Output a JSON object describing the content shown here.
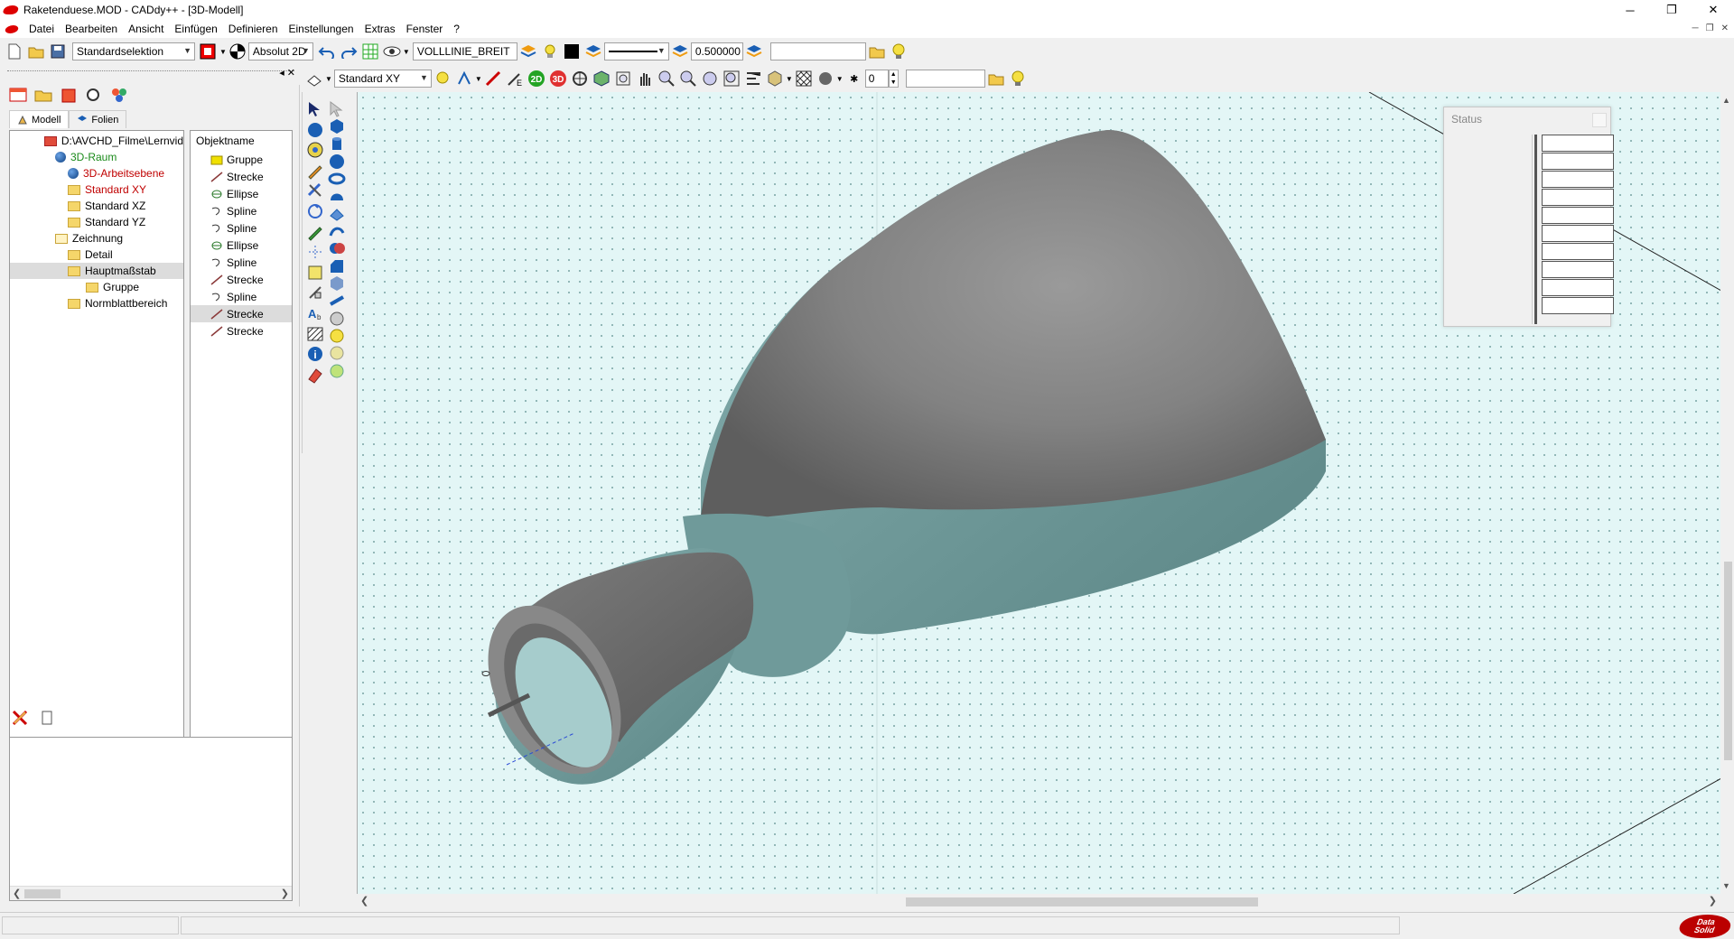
{
  "window": {
    "title": "Raketenduese.MOD - CADdy++ - [3D-Modell]",
    "minimize": "─",
    "maximize": "❐",
    "close": "✕"
  },
  "menu": {
    "items": [
      "Datei",
      "Bearbeiten",
      "Ansicht",
      "Einfügen",
      "Definieren",
      "Einstellungen",
      "Extras",
      "Fenster",
      "?"
    ]
  },
  "toolbar1": {
    "selection_mode": "Standardselektion",
    "coord_mode": "Absolut 2D",
    "line_type": "VOLLLINIE_BREIT",
    "line_width": "0.500000",
    "extra_field": ""
  },
  "toolbar2": {
    "view_plane": "Standard XY",
    "label_2d": "2D",
    "label_3d": "3D",
    "spin_value": "0",
    "extra_field": ""
  },
  "leftpanel": {
    "tabs": [
      {
        "label": "Modell"
      },
      {
        "label": "Folien"
      }
    ],
    "tree": [
      {
        "label": "D:\\AVCHD_Filme\\Lernvid",
        "color": "#000000"
      },
      {
        "label": "3D-Raum",
        "color": "#1a8a1a"
      },
      {
        "label": "3D-Arbeitsebene",
        "color": "#c00000"
      },
      {
        "label": "Standard XY",
        "color": "#c00000"
      },
      {
        "label": "Standard XZ",
        "color": "#000000"
      },
      {
        "label": "Standard YZ",
        "color": "#000000"
      },
      {
        "label": "Zeichnung",
        "color": "#000000"
      },
      {
        "label": "Detail",
        "color": "#000000"
      },
      {
        "label": "Hauptmaßstab",
        "color": "#000000"
      },
      {
        "label": "Gruppe",
        "color": "#000000"
      },
      {
        "label": "Normblattbereich",
        "color": "#000000"
      }
    ],
    "objects_header": "Objektname",
    "objects": [
      {
        "label": "Gruppe",
        "icon": "folder-icon"
      },
      {
        "label": "Strecke",
        "icon": "line-icon"
      },
      {
        "label": "Ellipse",
        "icon": "ellipse-icon"
      },
      {
        "label": "Spline",
        "icon": "spline-icon"
      },
      {
        "label": "Spline",
        "icon": "spline-icon"
      },
      {
        "label": "Ellipse",
        "icon": "ellipse-icon"
      },
      {
        "label": "Spline",
        "icon": "spline-icon"
      },
      {
        "label": "Strecke",
        "icon": "line-icon"
      },
      {
        "label": "Spline",
        "icon": "spline-icon"
      },
      {
        "label": "Strecke",
        "icon": "line-icon"
      },
      {
        "label": "Strecke",
        "icon": "line-icon"
      }
    ]
  },
  "status_window": {
    "title": "Status"
  },
  "brand": {
    "line1": "Data",
    "line2": "Solid"
  },
  "colors": {
    "viewport_bg": "#e3f6f6",
    "model_gray": "#7d7d7d",
    "model_teal": "#6b9595",
    "accent_red": "#c00000"
  }
}
